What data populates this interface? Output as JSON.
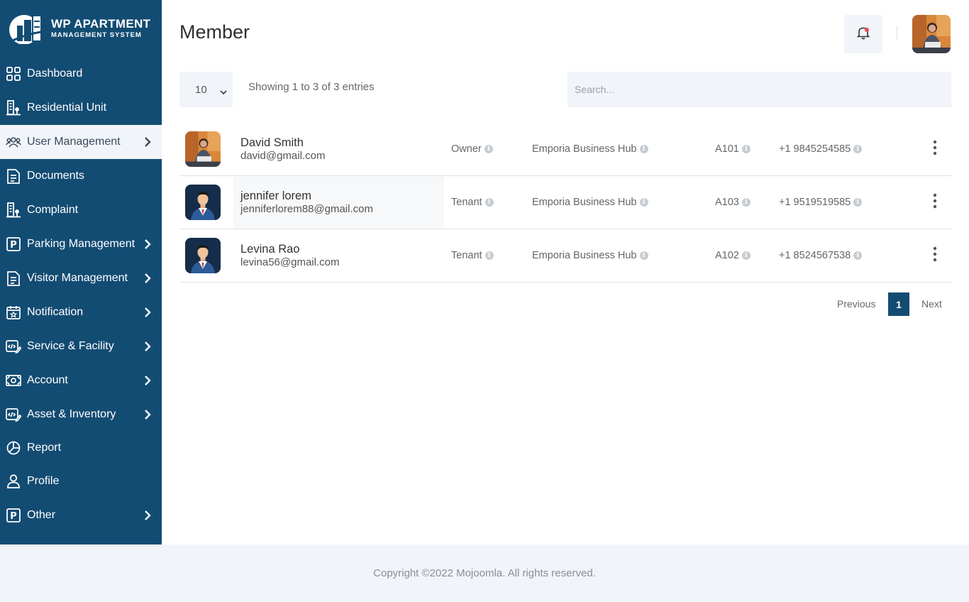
{
  "app": {
    "logo_title": "WP APARTMENT",
    "logo_subtitle": "MANAGEMENT SYSTEM"
  },
  "sidebar": {
    "items": [
      {
        "label": "Dashboard",
        "icon": "dashboard-icon",
        "has_submenu": false,
        "active": false
      },
      {
        "label": "Residential Unit",
        "icon": "building-icon",
        "has_submenu": false,
        "active": false
      },
      {
        "label": "User Management",
        "icon": "users-icon",
        "has_submenu": true,
        "active": true
      },
      {
        "label": "Documents",
        "icon": "document-icon",
        "has_submenu": false,
        "active": false
      },
      {
        "label": "Complaint",
        "icon": "building-icon",
        "has_submenu": false,
        "active": false
      },
      {
        "label": "Parking Management",
        "icon": "parking-icon",
        "has_submenu": true,
        "active": false
      },
      {
        "label": "Visitor Management",
        "icon": "document-icon",
        "has_submenu": true,
        "active": false
      },
      {
        "label": "Notification",
        "icon": "calendar-star-icon",
        "has_submenu": true,
        "active": false
      },
      {
        "label": "Service & Facility",
        "icon": "code-edit-icon",
        "has_submenu": true,
        "active": false
      },
      {
        "label": "Account",
        "icon": "money-icon",
        "has_submenu": true,
        "active": false
      },
      {
        "label": "Asset & Inventory",
        "icon": "code-edit-icon",
        "has_submenu": true,
        "active": false
      },
      {
        "label": "Report",
        "icon": "pie-chart-icon",
        "has_submenu": false,
        "active": false
      },
      {
        "label": "Profile",
        "icon": "user-icon",
        "has_submenu": false,
        "active": false
      },
      {
        "label": "Other",
        "icon": "parking-icon",
        "has_submenu": true,
        "active": false
      }
    ]
  },
  "header": {
    "title": "Member"
  },
  "controls": {
    "page_length": "10",
    "showing_text": "Showing 1 to 3 of 3 entries",
    "search_placeholder": "Search..."
  },
  "members": [
    {
      "name": "David Smith",
      "email": "david@gmail.com",
      "role": "Owner",
      "building": "Emporia Business Hub",
      "unit": "A101",
      "phone": "+1 9845254585",
      "avatar": "photo"
    },
    {
      "name": "jennifer lorem",
      "email": "jenniferlorem88@gmail.com",
      "role": "Tenant",
      "building": "Emporia Business Hub",
      "unit": "A103",
      "phone": "+1 9519519585",
      "avatar": "illustration"
    },
    {
      "name": "Levina Rao",
      "email": "levina56@gmail.com",
      "role": "Tenant",
      "building": "Emporia Business Hub",
      "unit": "A102",
      "phone": "+1 8524567538",
      "avatar": "illustration"
    }
  ],
  "pagination": {
    "previous": "Previous",
    "current": "1",
    "next": "Next"
  },
  "footer": {
    "copyright": "Copyright ©2022 Mojoomla. All rights reserved."
  },
  "colors": {
    "sidebar_bg": "#134c73",
    "active_bg": "#f1f4f9",
    "notification_dot": "#e84b4b"
  }
}
